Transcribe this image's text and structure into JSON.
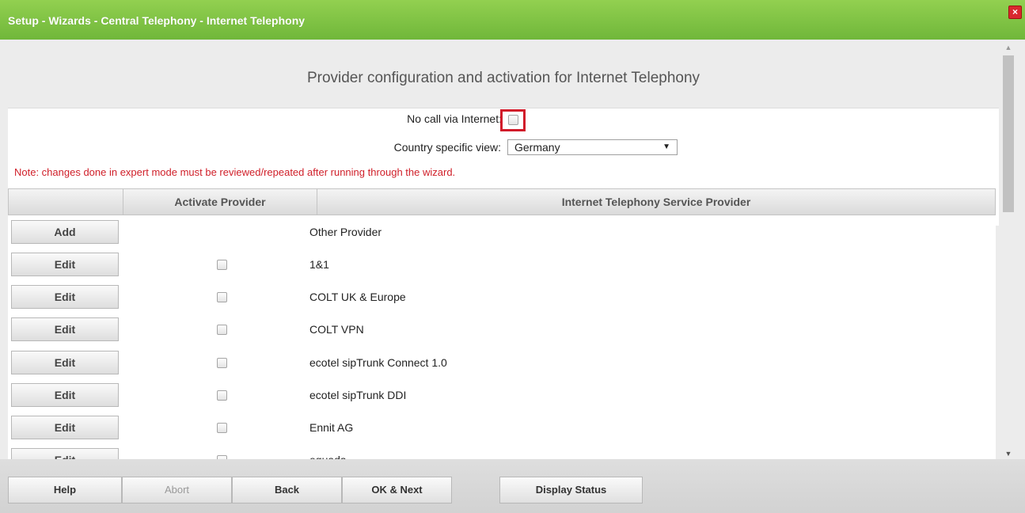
{
  "window": {
    "title": "Setup - Wizards - Central Telephony - Internet Telephony",
    "close_label": "×"
  },
  "page": {
    "heading": "Provider configuration and activation for Internet Telephony"
  },
  "form": {
    "no_call_label": "No call via Internet:",
    "no_call_checked": false,
    "country_label": "Country specific view:",
    "country_value": "Germany",
    "note": "Note: changes done in expert mode must be reviewed/repeated after running through the wizard."
  },
  "table": {
    "headers": [
      "",
      "Activate Provider",
      "Internet Telephony Service Provider"
    ],
    "rows": [
      {
        "button": "Add",
        "provider": "Other Provider",
        "has_checkbox": false
      },
      {
        "button": "Edit",
        "provider": "1&1",
        "has_checkbox": true
      },
      {
        "button": "Edit",
        "provider": "COLT UK & Europe",
        "has_checkbox": true
      },
      {
        "button": "Edit",
        "provider": "COLT VPN",
        "has_checkbox": true
      },
      {
        "button": "Edit",
        "provider": "ecotel sipTrunk Connect 1.0",
        "has_checkbox": true
      },
      {
        "button": "Edit",
        "provider": "ecotel sipTrunk DDI",
        "has_checkbox": true
      },
      {
        "button": "Edit",
        "provider": "Ennit AG",
        "has_checkbox": true
      },
      {
        "button": "Edit",
        "provider": "equada",
        "has_checkbox": true
      }
    ]
  },
  "footer": {
    "help": "Help",
    "abort": "Abort",
    "back": "Back",
    "ok_next": "OK & Next",
    "display_status": "Display Status"
  },
  "colors": {
    "title_bar": "#7cc142",
    "note_text": "#d0202a",
    "highlight_box": "#d11a2a"
  }
}
